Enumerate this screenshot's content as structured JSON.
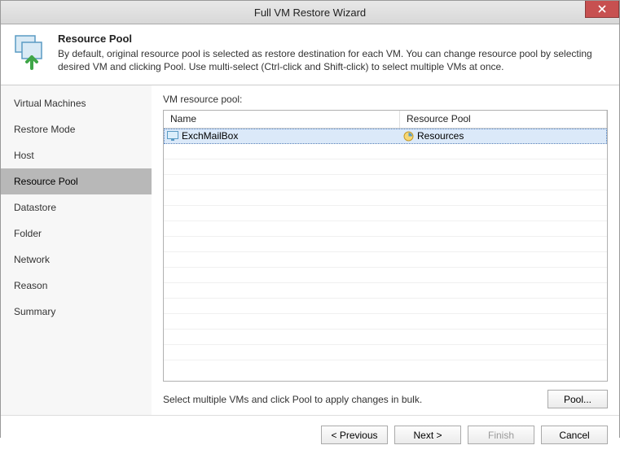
{
  "window": {
    "title": "Full VM Restore Wizard"
  },
  "header": {
    "title": "Resource Pool",
    "description": "By default, original resource pool is selected as restore destination for each VM. You can change resource pool by selecting desired VM and clicking Pool. Use multi-select (Ctrl-click and Shift-click) to select multiple VMs at once."
  },
  "sidebar": {
    "items": [
      {
        "label": "Virtual Machines"
      },
      {
        "label": "Restore Mode"
      },
      {
        "label": "Host"
      },
      {
        "label": "Resource Pool",
        "selected": true
      },
      {
        "label": "Datastore"
      },
      {
        "label": "Folder"
      },
      {
        "label": "Network"
      },
      {
        "label": "Reason"
      },
      {
        "label": "Summary"
      }
    ]
  },
  "main": {
    "label": "VM resource pool:",
    "columns": {
      "name": "Name",
      "pool": "Resource Pool"
    },
    "rows": [
      {
        "name": "ExchMailBox",
        "pool": "Resources",
        "selected": true
      }
    ],
    "hint": "Select multiple VMs and click Pool to apply changes in bulk.",
    "pool_button": "Pool..."
  },
  "footer": {
    "previous": "< Previous",
    "next": "Next >",
    "finish": "Finish",
    "cancel": "Cancel"
  }
}
